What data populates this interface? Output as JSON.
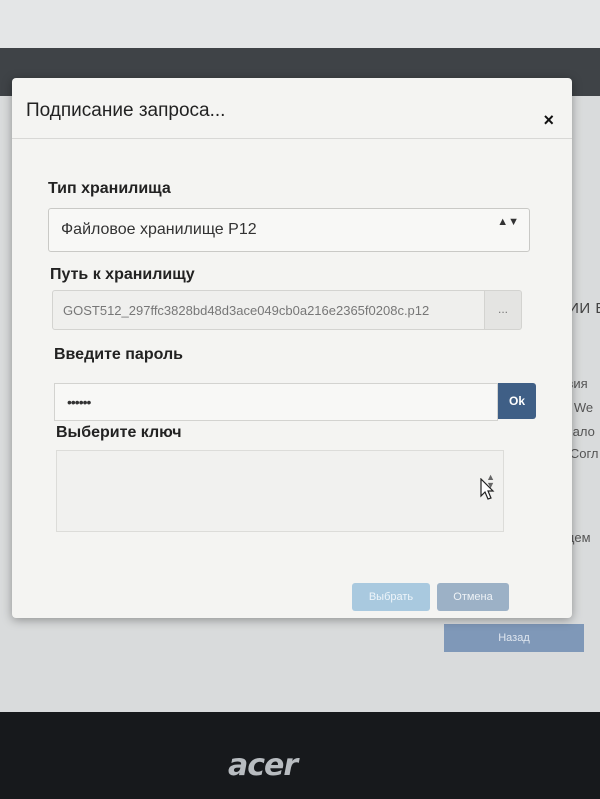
{
  "dialog": {
    "title": "Подписание запроса...",
    "close_label": "×",
    "storage_type": {
      "label": "Тип хранилища",
      "value": "Файловое хранилище P12",
      "arrows": "▲▼"
    },
    "storage_path": {
      "label": "Путь к хранилищу",
      "value": "GOST512_297ffc3828bd48d3ace049cb0a216e2365f0208c.p12",
      "browse_label": "..."
    },
    "password": {
      "label": "Введите пароль",
      "value": "••••••",
      "ok_label": "Ok"
    },
    "key": {
      "label": "Выберите ключ"
    },
    "buttons": {
      "select_label": "Выбрать",
      "cancel_label": "Отмена"
    }
  },
  "background": {
    "heading_fragment": "АЦИИ В",
    "lines": [
      "словия",
      "е на We",
      "ии (нало",
      "цего Согл"
    ],
    "line_fragment": "астоящем",
    "back_button_label": "Назад"
  },
  "device": {
    "brand": "acer"
  }
}
